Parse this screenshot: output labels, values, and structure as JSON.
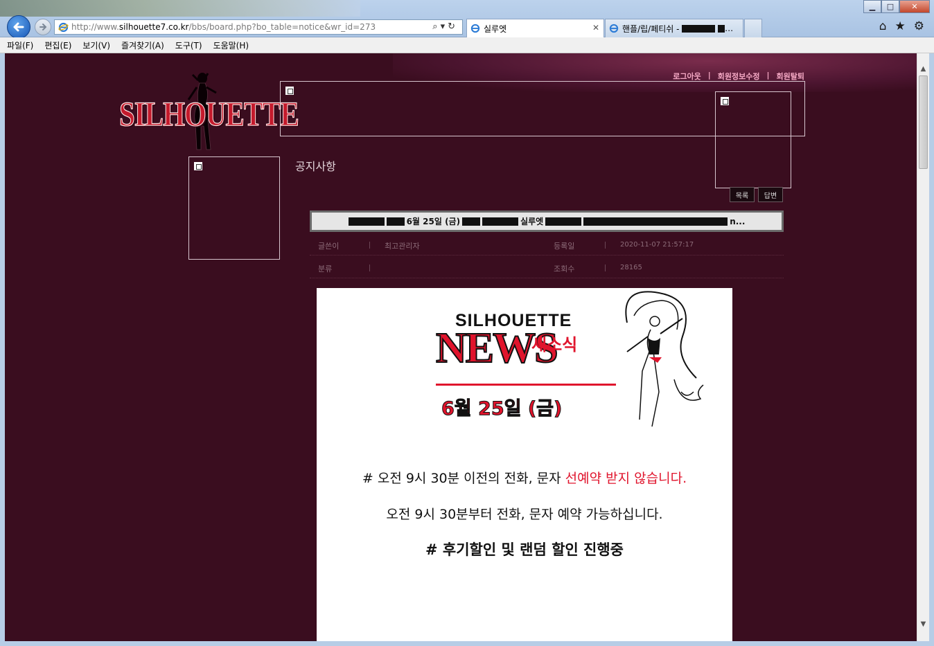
{
  "browser": {
    "url_prefix": "http://www.",
    "url_host": "silhouette7.co.kr",
    "url_path": "/bbs/board.php?bo_table=notice&wr_id=273",
    "active_tab": "실루엣",
    "inactive_tab": "핸플/립/페티쉬 -",
    "icons": [
      "back-arrow-icon",
      "forward-arrow-icon",
      "ie-logo-icon",
      "search-icon",
      "refresh-icon",
      "home-icon",
      "star-icon",
      "gear-icon",
      "close-icon"
    ],
    "window": {
      "minimize": "▁",
      "maximize": "□",
      "close": "✕"
    }
  },
  "menu": [
    "파일(F)",
    "편집(E)",
    "보기(V)",
    "즐겨찾기(A)",
    "도구(T)",
    "도움말(H)"
  ],
  "site": {
    "logo_text": "SILHOUETTE",
    "top_links": [
      "로그아웃",
      "회원정보수정",
      "회원탈퇴"
    ],
    "separator": "|",
    "board_title": "공지사항",
    "buttons": {
      "list": "목록",
      "reply": "답변"
    },
    "colors": {
      "page_bg": "#3a0d1f",
      "link_pink": "#f6a9c5",
      "logo_red": "#c41a2c"
    }
  },
  "post": {
    "subject_visible": "6월 25일 (금)",
    "subject_mid": "실루엣",
    "subject_tail": "n...",
    "labels": {
      "author": "글쓴이",
      "date": "등록일",
      "category": "분류",
      "views": "조회수"
    },
    "author": "최고관리자",
    "date": "2020-11-07 21:57:17",
    "category": "",
    "views": "28165"
  },
  "content": {
    "banner_top": "SILHOUETTE",
    "banner_big": "NEWS",
    "banner_kr": "새소식",
    "banner_date": "6월 25일 (금)",
    "line1_prefix": "#  오전 9시 30분 이전의 전화, 문자 ",
    "line1_red": "선예약 받지 않습니다.",
    "line2": "오전 9시 30분부터 전화, 문자 예약 가능하십니다.",
    "line3": "# 후기할인 및 랜덤 할인 진행중"
  }
}
